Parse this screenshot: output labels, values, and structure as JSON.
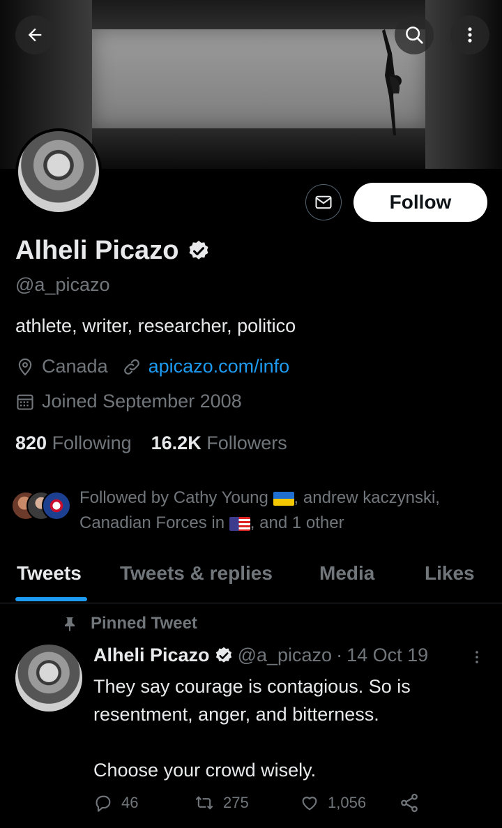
{
  "profile": {
    "name": "Alheli Picazo",
    "handle": "@a_picazo",
    "bio": "athlete, writer, researcher, politico",
    "location": "Canada",
    "website": "apicazo.com/info",
    "joined": "Joined September 2008",
    "following_count": "820",
    "following_label": "Following",
    "followers_count": "16.2K",
    "followers_label": "Followers",
    "follow_button": "Follow"
  },
  "followed_by": {
    "part1": "Followed by Cathy Young",
    "part2": ", andrew kaczynski,",
    "part3": "Canadian Forces in",
    "part4": ", and 1 other"
  },
  "tabs": [
    {
      "label": "Tweets"
    },
    {
      "label": "Tweets & replies"
    },
    {
      "label": "Media"
    },
    {
      "label": "Likes"
    }
  ],
  "pinned_tweet": {
    "pinned_label": "Pinned Tweet",
    "author_name": "Alheli Picazo",
    "author_handle": "@a_picazo",
    "separator": "·",
    "date": "14 Oct 19",
    "text_line1": "They say courage is contagious. So is resentment, anger, and bitterness.",
    "text_line2": "Choose your crowd wisely.",
    "replies": "46",
    "retweets": "275",
    "likes": "1,056"
  },
  "icons": [
    "back-arrow-icon",
    "search-icon",
    "more-vertical-icon",
    "mail-icon",
    "verified-icon",
    "location-pin-icon",
    "link-icon",
    "calendar-icon",
    "pin-icon",
    "reply-icon",
    "retweet-icon",
    "like-icon",
    "share-icon"
  ],
  "colors": {
    "accent": "#1d9bf0",
    "muted": "#71767b",
    "text": "#e7e9ea",
    "background": "#000000"
  }
}
